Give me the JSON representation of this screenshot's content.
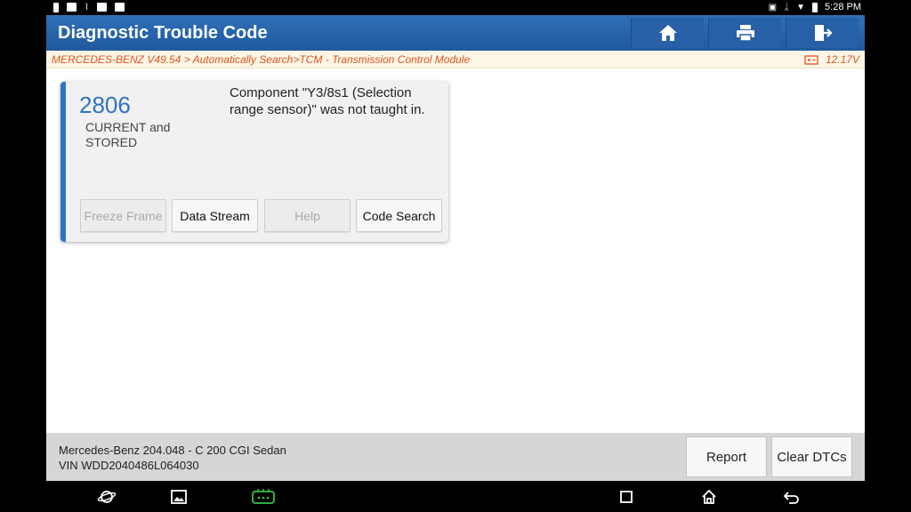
{
  "statusbar": {
    "time": "5:28 PM"
  },
  "header": {
    "title": "Diagnostic Trouble Code",
    "buttons": [
      {
        "icon": "home-icon"
      },
      {
        "icon": "printer-icon"
      },
      {
        "icon": "exit-icon"
      }
    ]
  },
  "breadcrumb": {
    "path": "MERCEDES-BENZ V49.54 > Automatically Search>TCM - Transmission Control Module",
    "voltage": "12.17V"
  },
  "dtc": {
    "code": "2806",
    "status": "CURRENT and STORED",
    "description": "Component \"Y3/8s1 (Selection range sensor)\" was not taught in.",
    "buttons": {
      "freeze_frame": "Freeze Frame",
      "data_stream": "Data Stream",
      "help": "Help",
      "code_search": "Code Search"
    }
  },
  "footer": {
    "vehicle": "Mercedes-Benz 204.048 - C 200 CGI Sedan",
    "vin": "VIN WDD2040486L064030",
    "report": "Report",
    "clear": "Clear DTCs"
  },
  "colors": {
    "accent": "#2f73c2",
    "header": "#205a9d",
    "crumb": "#e0541f"
  }
}
